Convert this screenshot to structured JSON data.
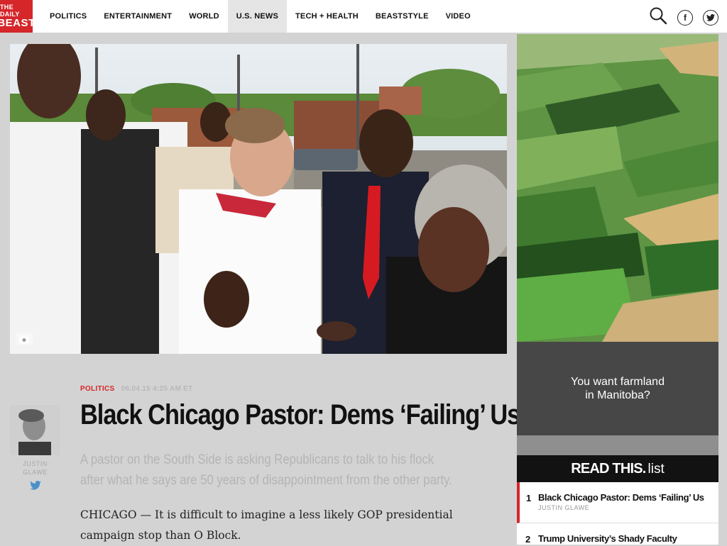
{
  "header": {
    "logo_line1": "THE DAILY",
    "logo_line2": "BEAST",
    "nav": [
      {
        "label": "POLITICS"
      },
      {
        "label": "ENTERTAINMENT"
      },
      {
        "label": "WORLD"
      },
      {
        "label": "U.S. NEWS"
      },
      {
        "label": "TECH + HEALTH"
      },
      {
        "label": "BEASTSTYLE"
      },
      {
        "label": "VIDEO"
      }
    ],
    "active_nav": "U.S. NEWS"
  },
  "article": {
    "section": "POLITICS",
    "date": "06.04.15 4:25 AM ET",
    "headline": "Black Chicago Pastor: Dems ‘Failing’ Us",
    "dek": "A pastor on the South Side is asking Republicans to talk to his flock after what he says are 50 years of disappointment from the other party.",
    "body": "CHICAGO — It is difficult to imagine a less likely GOP presidential campaign stop than O Block."
  },
  "author": {
    "name_line1": "JUSTIN",
    "name_line2": "GLAWE"
  },
  "ad": {
    "line1": "You want farmland",
    "line2": "in Manitoba?"
  },
  "read_this": {
    "title_bold": "READ THIS.",
    "title_light": "list",
    "items": [
      {
        "num": "1",
        "title": "Black Chicago Pastor: Dems ‘Failing’ Us",
        "author": "JUSTIN GLAWE"
      },
      {
        "num": "2",
        "title": "Trump University’s Shady Faculty",
        "author": ""
      }
    ]
  },
  "colors": {
    "brand_red": "#d5262a",
    "page_bg": "#d3d3d3",
    "twitter_blue": "#4a90c9"
  }
}
